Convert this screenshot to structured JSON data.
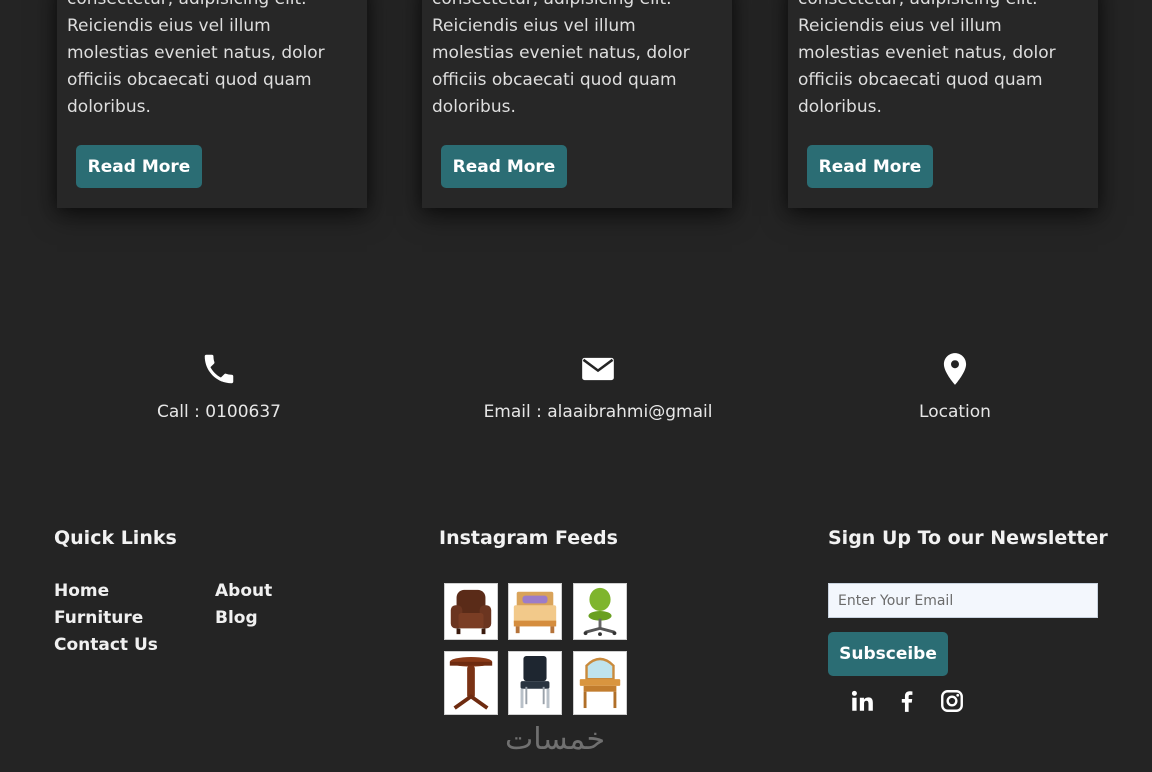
{
  "cards": [
    {
      "text": "Lorem ipsum dolor sit amet consectetur, adipisicing elit. Reiciendis eius vel illum molestias eveniet natus, dolor officiis obcaecati quod quam doloribus.",
      "button": "Read More"
    },
    {
      "text": "Lorem ipsum dolor sit amet consectetur, adipisicing elit. Reiciendis eius vel illum molestias eveniet natus, dolor officiis obcaecati quod quam doloribus.",
      "button": "Read More"
    },
    {
      "text": "Lorem ipsum dolor sit amet consectetur, adipisicing elit. Reiciendis eius vel illum molestias eveniet natus, dolor officiis obcaecati quod quam doloribus.",
      "button": "Read More"
    }
  ],
  "contact": {
    "call": {
      "icon": "phone-icon",
      "text": "Call : 0100637"
    },
    "email": {
      "icon": "envelope-icon",
      "text": "Email : alaaibrahmi@gmail"
    },
    "location": {
      "icon": "map-pin-icon",
      "text": "Location"
    }
  },
  "quick_links": {
    "title": "Quick Links",
    "items": [
      "Home",
      "About",
      "Furniture",
      "Blog",
      "Contact Us"
    ]
  },
  "instagram": {
    "title": "Instagram Feeds",
    "images": [
      "armchair-image",
      "bed-image",
      "office-chair-image",
      "side-table-image",
      "dining-chair-image",
      "vanity-mirror-image"
    ]
  },
  "newsletter": {
    "title": "Sign Up To our Newsletter",
    "placeholder": "Enter Your Email",
    "button": "Subsceibe",
    "social": [
      "linkedin-icon",
      "facebook-icon",
      "instagram-icon"
    ]
  },
  "watermark": "خمسات",
  "colors": {
    "background": "#242424",
    "card": "#272727",
    "accent": "#2b6d74",
    "text": "#e9e9e9"
  }
}
